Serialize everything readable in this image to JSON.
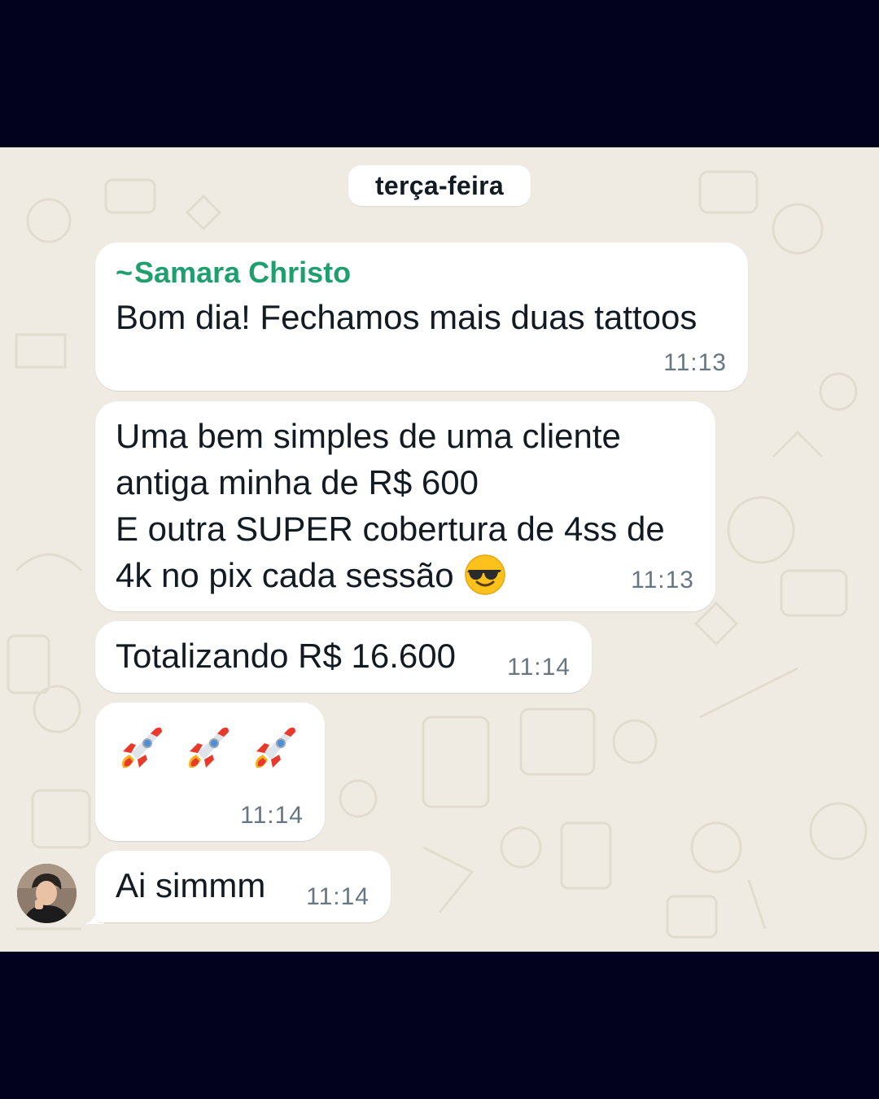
{
  "date_separator": "terça-feira",
  "messages": [
    {
      "sender": "Samara Christo",
      "sender_prefix": "~",
      "lines": [
        "Bom dia! Fechamos mais duas tattoos"
      ],
      "time": "11:13"
    },
    {
      "lines": [
        "Uma bem simples de uma cliente",
        "antiga minha de R$ 600",
        "E outra SUPER cobertura de 4ss de",
        "4k no pix cada sessão"
      ],
      "trailing_emoji": "smiling-face-with-sunglasses-icon",
      "time": "11:13"
    },
    {
      "lines": [
        "Totalizando R$ 16.600"
      ],
      "time": "11:14"
    },
    {
      "emojis": [
        "rocket-icon",
        "rocket-icon",
        "rocket-icon"
      ],
      "time": "11:14"
    },
    {
      "lines": [
        "Ai simmm"
      ],
      "time": "11:14"
    }
  ],
  "colors": {
    "sender_name": "#1f9f6d",
    "chat_background": "#efeae2",
    "frame_background": "#02021e",
    "bubble": "#ffffff",
    "timestamp": "#667781"
  }
}
